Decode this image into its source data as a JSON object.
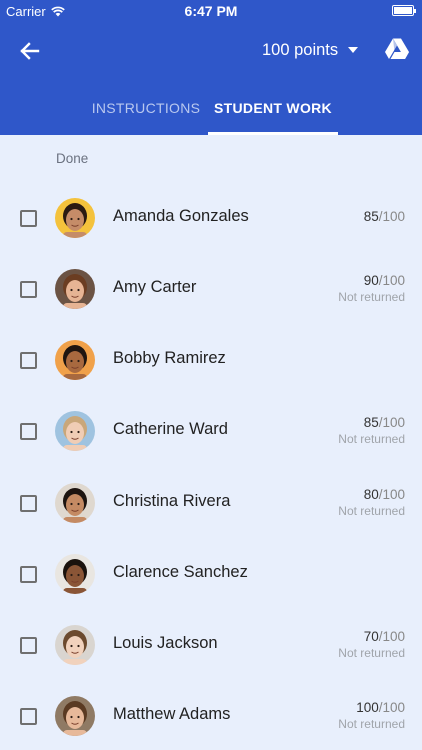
{
  "status_bar": {
    "carrier": "Carrier",
    "time": "6:47 PM"
  },
  "header": {
    "points_label": "100 points",
    "tabs": [
      {
        "label": "INSTRUCTIONS",
        "active": false
      },
      {
        "label": "STUDENT WORK",
        "active": true
      }
    ]
  },
  "section": {
    "label": "Done"
  },
  "students": [
    {
      "name": "Amanda Gonzales",
      "score": "85",
      "max": "/100",
      "status": "",
      "skin": "#c58c68",
      "hair": "#2a1a12",
      "bg": "#f4c23c"
    },
    {
      "name": "Amy Carter",
      "score": "90",
      "max": "/100",
      "status": "Not returned",
      "skin": "#e6b494",
      "hair": "#6b3d22",
      "bg": "#6b5344"
    },
    {
      "name": "Bobby Ramirez",
      "score": "",
      "max": "",
      "status": "",
      "skin": "#a8693f",
      "hair": "#1f1510",
      "bg": "#f0a14a"
    },
    {
      "name": "Catherine Ward",
      "score": "85",
      "max": "/100",
      "status": "Not returned",
      "skin": "#f0cdb5",
      "hair": "#c9a77a",
      "bg": "#9fc3e0"
    },
    {
      "name": "Christina Rivera",
      "score": "80",
      "max": "/100",
      "status": "Not returned",
      "skin": "#c48a63",
      "hair": "#1d1410",
      "bg": "#dfd8cf"
    },
    {
      "name": "Clarence Sanchez",
      "score": "",
      "max": "",
      "status": "",
      "skin": "#8a5536",
      "hair": "#1a120d",
      "bg": "#e9e6e1"
    },
    {
      "name": "Louis Jackson",
      "score": "70",
      "max": "/100",
      "status": "Not returned",
      "skin": "#f1d2bd",
      "hair": "#6c4a2e",
      "bg": "#d9d5d0"
    },
    {
      "name": "Matthew Adams",
      "score": "100",
      "max": "/100",
      "status": "Not returned",
      "skin": "#e7b99a",
      "hair": "#5a3a22",
      "bg": "#8f7a64"
    }
  ]
}
